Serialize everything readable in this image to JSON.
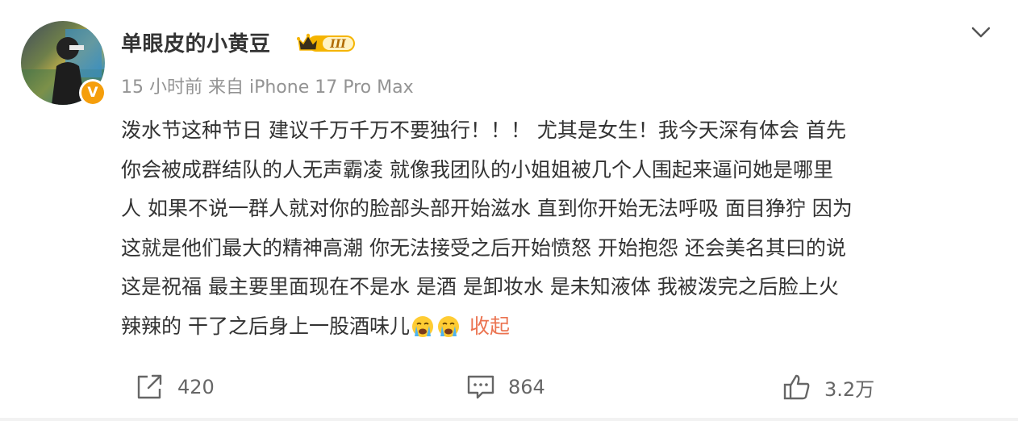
{
  "post": {
    "username": "单眼皮的小黄豆",
    "badge_text": "III",
    "verified_mark": "V",
    "meta": "15 小时前 来自 iPhone 17 Pro Max",
    "text_lines": [
      "泼水节这种节日 建议千万千万不要独行！！！ 尤其是女生！我今天深有体会 首先",
      "你会被成群结队的人无声霸凌 就像我团队的小姐姐被几个人围起来逼问她是哪里",
      "人 如果不说一群人就对你的脸部头部开始滋水 直到你开始无法呼吸 面目狰狞 因为",
      "这就是他们最大的精神高潮 你无法接受之后开始愤怒 开始抱怨 还会美名其曰的说",
      "这是祝福 最主要里面现在不是水 是酒 是卸妆水 是未知液体 我被泼完之后脸上火",
      "辣辣的 干了之后身上一股酒味儿"
    ],
    "emojis": [
      "crying-emoji",
      "crying-emoji"
    ],
    "collapse_label": "收起"
  },
  "actions": {
    "share_count": "420",
    "comment_count": "864",
    "like_count": "3.2万"
  },
  "colors": {
    "accent": "#eb7350",
    "meta_gray": "#939393",
    "badge_gold": "#f5b400"
  }
}
